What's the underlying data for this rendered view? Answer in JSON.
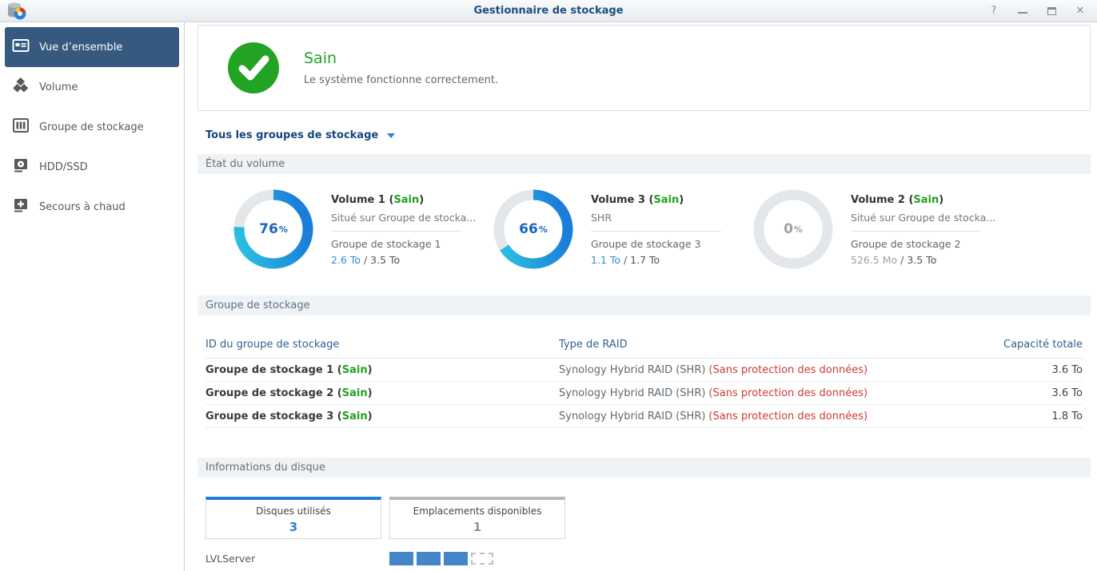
{
  "window": {
    "title": "Gestionnaire de stockage",
    "controls": {
      "help": "?",
      "close": "✕"
    }
  },
  "sidebar": {
    "items": [
      {
        "key": "overview",
        "label": "Vue d’ensemble",
        "icon": "overview-icon",
        "active": true
      },
      {
        "key": "volume",
        "label": "Volume",
        "icon": "volume-icon",
        "active": false
      },
      {
        "key": "storage-pool",
        "label": "Groupe de stockage",
        "icon": "storage-pool-icon",
        "active": false
      },
      {
        "key": "hdd-ssd",
        "label": "HDD/SSD",
        "icon": "hdd-icon",
        "active": false
      },
      {
        "key": "hot-spare",
        "label": "Secours à chaud",
        "icon": "hot-spare-icon",
        "active": false
      }
    ]
  },
  "health": {
    "status": "Sain",
    "description": "Le système fonctionne correctement."
  },
  "group_filter": {
    "label": "Tous les groupes de stockage"
  },
  "sections": {
    "volume_status": "État du volume",
    "storage_group": "Groupe de stockage",
    "disk_info": "Informations du disque"
  },
  "volumes": [
    {
      "name": "Volume 1",
      "status": "Sain",
      "percent": 76,
      "subtitle": "Situé sur Groupe de stocka...",
      "group": "Groupe de stockage 1",
      "used": "2.6 To",
      "total": "3.5 To",
      "used_style": "link"
    },
    {
      "name": "Volume 3",
      "status": "Sain",
      "percent": 66,
      "subtitle": "SHR",
      "group": "Groupe de stockage 3",
      "used": "1.1 To",
      "total": "1.7 To",
      "used_style": "link"
    },
    {
      "name": "Volume 2",
      "status": "Sain",
      "percent": 0,
      "subtitle": "Situé sur Groupe de stocka...",
      "group": "Groupe de stockage 2",
      "used": "526.5 Mo",
      "total": "3.5 To",
      "used_style": "muted"
    }
  ],
  "storage_table": {
    "columns": [
      "ID du groupe de stockage",
      "Type de RAID",
      "Capacité totale"
    ],
    "rows": [
      {
        "id": "Groupe de stockage 1",
        "status": "Sain",
        "raid": "Synology Hybrid RAID (SHR)",
        "warning": "(Sans protection des données)",
        "capacity": "3.6 To"
      },
      {
        "id": "Groupe de stockage 2",
        "status": "Sain",
        "raid": "Synology Hybrid RAID (SHR)",
        "warning": "(Sans protection des données)",
        "capacity": "3.6 To"
      },
      {
        "id": "Groupe de stockage 3",
        "status": "Sain",
        "raid": "Synology Hybrid RAID (SHR)",
        "warning": "(Sans protection des données)",
        "capacity": "1.8 To"
      }
    ]
  },
  "disk_info": {
    "tabs": [
      {
        "label": "Disques utilisés",
        "count": "3",
        "active": true
      },
      {
        "label": "Emplacements disponibles",
        "count": "1",
        "active": false
      }
    ],
    "server": {
      "name": "LVLServer",
      "used_slots": 3,
      "empty_slots": 1
    }
  },
  "colors": {
    "accent_blue": "#1b7ed7",
    "healthy_green": "#23a323",
    "warning_red": "#cc3b33",
    "donut_gradient_start": "#2cc3e2",
    "donut_gradient_end": "#1b7fd9",
    "donut_track": "#e3e7ea",
    "sidebar_active": "#35597f"
  }
}
